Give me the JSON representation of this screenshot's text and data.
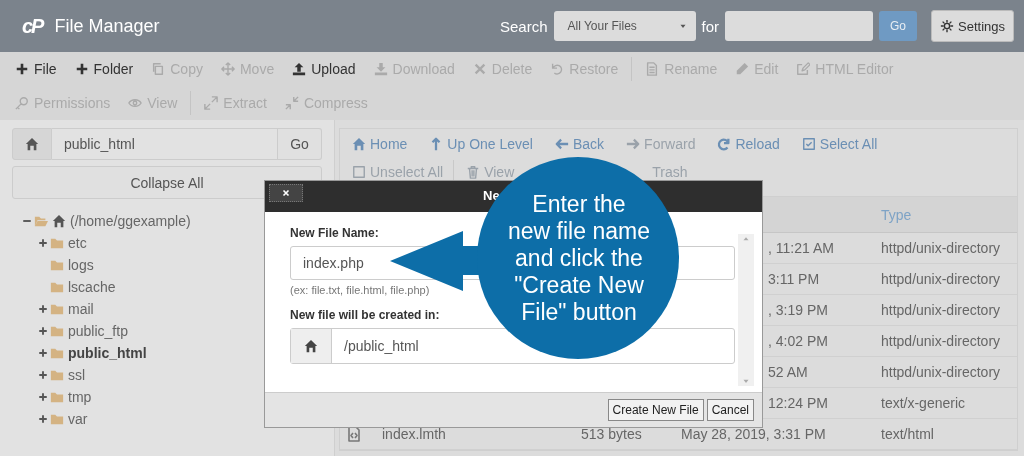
{
  "header": {
    "logo": "cP",
    "title": "File Manager",
    "search_label": "Search",
    "scope": "All Your Files",
    "for_label": "for",
    "go": "Go",
    "settings": "Settings"
  },
  "toolbar": [
    [
      [
        {
          "label": "File",
          "kind": "plus",
          "disabled": false
        },
        {
          "label": "Folder",
          "kind": "plus",
          "disabled": false
        },
        {
          "label": "Copy",
          "kind": "copy",
          "disabled": true
        },
        {
          "label": "Move",
          "kind": "move",
          "disabled": true
        },
        {
          "label": "Upload",
          "kind": "upload",
          "disabled": false
        },
        {
          "label": "Download",
          "kind": "download",
          "disabled": true
        },
        {
          "label": "Delete",
          "kind": "delete",
          "disabled": true
        },
        {
          "label": "Restore",
          "kind": "restore",
          "disabled": true
        }
      ],
      [
        {
          "label": "Rename",
          "kind": "rename",
          "disabled": true
        },
        {
          "label": "Edit",
          "kind": "pencil",
          "disabled": true
        },
        {
          "label": "HTML Editor",
          "kind": "html",
          "disabled": true
        }
      ]
    ],
    [
      [
        {
          "label": "Permissions",
          "kind": "key",
          "disabled": true
        },
        {
          "label": "View",
          "kind": "eye",
          "disabled": true
        }
      ],
      [
        {
          "label": "Extract",
          "kind": "expand",
          "disabled": true
        },
        {
          "label": "Compress",
          "kind": "compress",
          "disabled": true
        }
      ]
    ]
  ],
  "path_bar": {
    "value": "public_html",
    "go": "Go"
  },
  "collapse_all": "Collapse All",
  "tree": [
    {
      "label": "(/home/ggexample)",
      "kind": "home",
      "expanded": true,
      "selected": false,
      "children": [
        {
          "label": "etc",
          "kind": "folder",
          "expanded": false,
          "selected": false
        },
        {
          "label": "logs",
          "kind": "leaf",
          "selected": false
        },
        {
          "label": "lscache",
          "kind": "leaf",
          "selected": false
        },
        {
          "label": "mail",
          "kind": "folder",
          "expanded": false,
          "selected": false
        },
        {
          "label": "public_ftp",
          "kind": "folder",
          "expanded": false,
          "selected": false
        },
        {
          "label": "public_html",
          "kind": "folder",
          "expanded": false,
          "selected": true
        },
        {
          "label": "ssl",
          "kind": "folder",
          "expanded": false,
          "selected": false
        },
        {
          "label": "tmp",
          "kind": "folder",
          "expanded": false,
          "selected": false
        },
        {
          "label": "var",
          "kind": "folder",
          "expanded": false,
          "selected": false
        }
      ]
    }
  ],
  "nav": [
    [
      [
        {
          "label": "Home",
          "kind": "home",
          "disabled": false
        },
        {
          "label": "Up One Level",
          "kind": "up",
          "disabled": false
        },
        {
          "label": "Back",
          "kind": "back",
          "disabled": false
        },
        {
          "label": "Forward",
          "kind": "forward",
          "disabled": true
        },
        {
          "label": "Reload",
          "kind": "reload",
          "disabled": false
        },
        {
          "label": "Select All",
          "kind": "checked",
          "disabled": false
        }
      ]
    ],
    [
      [
        {
          "label": "Unselect All",
          "kind": "unchecked",
          "disabled": true
        }
      ],
      [
        {
          "label": "View",
          "kind": "trash",
          "disabled": true
        },
        {
          "label": "Trash",
          "kind": "none",
          "disabled": true
        }
      ]
    ]
  ],
  "table": {
    "columns": [
      {
        "label": "Type"
      }
    ],
    "rows": [
      {
        "modified": ", 11:21 AM",
        "type": "httpd/unix-directory"
      },
      {
        "modified": "3:11 PM",
        "type": "httpd/unix-directory"
      },
      {
        "modified": ", 3:19 PM",
        "type": "httpd/unix-directory"
      },
      {
        "modified": ", 4:02 PM",
        "type": "httpd/unix-directory"
      },
      {
        "modified": "52 AM",
        "type": "httpd/unix-directory"
      },
      {
        "modified": "12:24 PM",
        "type": "text/x-generic"
      },
      {
        "name": "index.lmth",
        "size": "513 bytes",
        "modified": "May 28, 2019, 3:31 PM",
        "type": "text/html"
      }
    ]
  },
  "dialog": {
    "title": "Ne",
    "name_label": "New File Name:",
    "name_value": "index.php",
    "hint": "(ex: file.txt, file.html, file.php)",
    "dir_label": "New file will be created in:",
    "dir_value": "/public_html",
    "buttons": [
      "Create New File",
      "Cancel"
    ]
  },
  "callout": "Enter the\nnew file name\nand click the\n\"Create New\nFile\" button"
}
